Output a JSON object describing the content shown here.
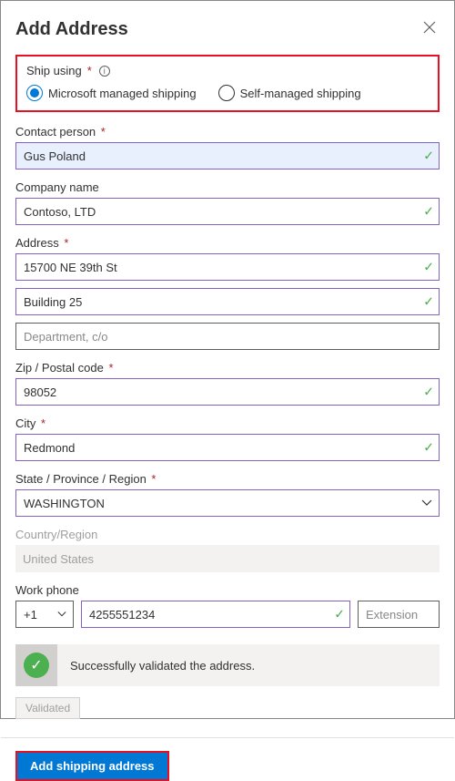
{
  "header": {
    "title": "Add Address"
  },
  "shipUsing": {
    "label": "Ship using",
    "options": {
      "managed": "Microsoft managed shipping",
      "self": "Self-managed shipping"
    }
  },
  "fields": {
    "contactPerson": {
      "label": "Contact person",
      "value": "Gus Poland"
    },
    "companyName": {
      "label": "Company name",
      "value": "Contoso, LTD"
    },
    "address": {
      "label": "Address",
      "line1": "15700 NE 39th St",
      "line2": "Building 25",
      "line3_placeholder": "Department, c/o"
    },
    "zip": {
      "label": "Zip / Postal code",
      "value": "98052"
    },
    "city": {
      "label": "City",
      "value": "Redmond"
    },
    "state": {
      "label": "State / Province / Region",
      "value": "WASHINGTON"
    },
    "country": {
      "label": "Country/Region",
      "value": "United States"
    },
    "workPhone": {
      "label": "Work phone",
      "cc": "+1",
      "number": "4255551234",
      "ext_placeholder": "Extension"
    }
  },
  "status": {
    "message": "Successfully validated the address.",
    "validatedBtn": "Validated"
  },
  "footer": {
    "primary": "Add shipping address"
  }
}
